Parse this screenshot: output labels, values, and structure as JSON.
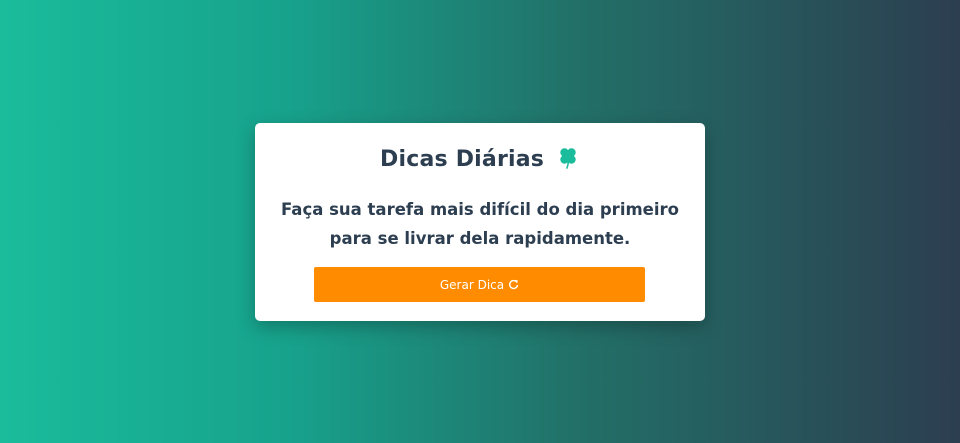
{
  "card": {
    "title": "Dicas Diárias",
    "title_icon": "four-leaf-clover-icon",
    "tip_text": "Faça sua tarefa mais difícil do dia primeiro para se livrar dela rapidamente.",
    "button_label": "Gerar Dica",
    "button_icon": "refresh-icon"
  },
  "colors": {
    "gradient_start": "#1abc9c",
    "gradient_end": "#2c3e50",
    "text": "#2c3e50",
    "accent_button": "#ff8c00",
    "clover": "#1abc9c"
  }
}
